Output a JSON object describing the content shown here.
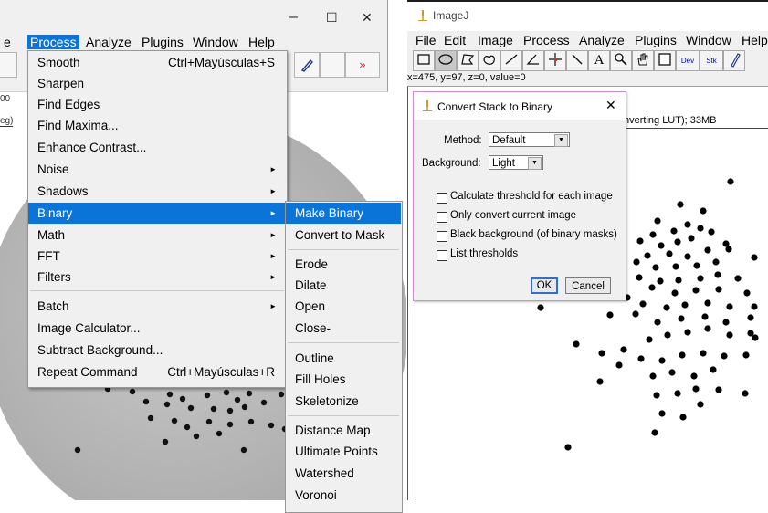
{
  "left_window": {
    "controls": {
      "minimize": "–",
      "maximize": "☐",
      "close": "✕"
    },
    "menubar": [
      {
        "label": "e"
      },
      {
        "label": "Process",
        "selected": true
      },
      {
        "label": "Analyze"
      },
      {
        "label": "Plugins"
      },
      {
        "label": "Window"
      },
      {
        "label": "Help"
      }
    ],
    "toolbar_more": "»",
    "side_texts": [
      "00",
      "eg)"
    ]
  },
  "process_menu": {
    "items": [
      {
        "label": "Smooth",
        "accel": "Ctrl+Mayúsculas+S"
      },
      {
        "label": "Sharpen"
      },
      {
        "label": "Find Edges"
      },
      {
        "label": "Find Maxima..."
      },
      {
        "label": "Enhance Contrast..."
      },
      {
        "label": "Noise",
        "submenu": true
      },
      {
        "label": "Shadows",
        "submenu": true
      },
      {
        "label": "Binary",
        "submenu": true,
        "highlighted": true
      },
      {
        "label": "Math",
        "submenu": true
      },
      {
        "label": "FFT",
        "submenu": true
      },
      {
        "label": "Filters",
        "submenu": true
      },
      {
        "label": "Batch",
        "submenu": true
      },
      {
        "label": "Image Calculator..."
      },
      {
        "label": "Subtract Background..."
      },
      {
        "label": "Repeat Command",
        "accel": "Ctrl+Mayúsculas+R"
      }
    ],
    "submenu_arrow": "►"
  },
  "binary_submenu": {
    "items": [
      {
        "label": "Make Binary",
        "highlighted": true
      },
      {
        "label": "Convert to Mask"
      },
      {
        "label": "Erode"
      },
      {
        "label": "Dilate"
      },
      {
        "label": "Open"
      },
      {
        "label": "Close-"
      },
      {
        "label": "Outline"
      },
      {
        "label": "Fill Holes"
      },
      {
        "label": "Skeletonize"
      },
      {
        "label": "Distance Map"
      },
      {
        "label": "Ultimate Points"
      },
      {
        "label": "Watershed"
      },
      {
        "label": "Voronoi"
      }
    ]
  },
  "imagej": {
    "title": "ImageJ",
    "menubar": [
      "File",
      "Edit",
      "Image",
      "Process",
      "Analyze",
      "Plugins",
      "Window",
      "Help"
    ],
    "tool_labels": {
      "text": "A",
      "dev": "Dev",
      "stk": "Stk"
    },
    "status": "x=475, y=97, z=0, value=0",
    "image_info": "nverting LUT); 33MB"
  },
  "dialog": {
    "title": "Convert Stack to Binary",
    "close": "✕",
    "method_label": "Method:",
    "method_value": "Default",
    "background_label": "Background:",
    "background_value": "Light",
    "dropdown_arrow": "▼",
    "checkboxes": [
      {
        "label": "Calculate threshold for each image",
        "checked": false
      },
      {
        "label": "Only convert current image",
        "checked": false
      },
      {
        "label": "Black background (of binary masks)",
        "checked": false
      },
      {
        "label": "List thresholds",
        "checked": false
      }
    ],
    "ok_label": "OK",
    "cancel_label": "Cancel"
  },
  "colors": {
    "highlight": "#0a74d8",
    "menu_bg": "#f0f0f0",
    "dialog_border": "#c98fd0",
    "photo_grey": "#b3b3b3"
  }
}
